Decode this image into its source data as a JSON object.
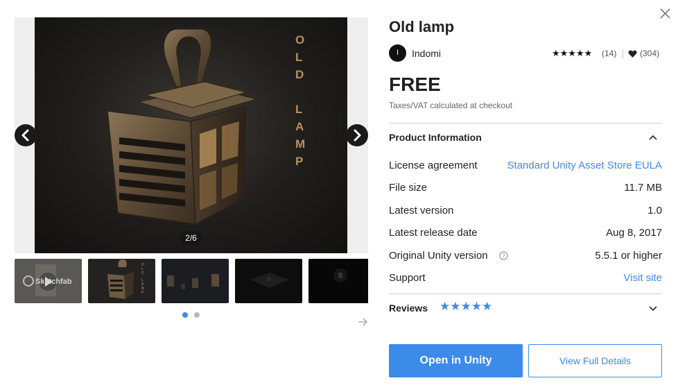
{
  "colors": {
    "accent": "#3d8be8",
    "text": "#212121",
    "muted": "#666666",
    "divider": "#cfcfcf"
  },
  "gallery": {
    "counter": "2/6",
    "prev_icon": "chevron-left-icon",
    "next_icon": "chevron-right-icon",
    "main_image_text": "OLD LAMP",
    "thumbnail_1_watermark": "Sketchfab",
    "thumbnail_2_text": "OLD LAMP",
    "dots_total": 2,
    "dots_active": 1,
    "thumb_next_icon": "arrow-right-icon"
  },
  "product": {
    "title": "Old lamp",
    "publisher_initial": "I",
    "publisher": "Indomi",
    "rating_stars": 5,
    "rating_count": "(14)",
    "favorites_count": "(304)",
    "price": "FREE",
    "tax_note": "Taxes/VAT calculated at checkout"
  },
  "info": {
    "heading": "Product Information",
    "rows": [
      {
        "label": "License agreement",
        "value": "Standard Unity Asset Store EULA"
      },
      {
        "label": "File size",
        "value": "11.7 MB"
      },
      {
        "label": "Latest version",
        "value": "1.0"
      },
      {
        "label": "Latest release date",
        "value": "Aug 8, 2017"
      },
      {
        "label": "Original Unity version",
        "value": "5.5.1 or higher"
      },
      {
        "label": "Support",
        "value": "Visit site"
      }
    ]
  },
  "reviews": {
    "heading": "Reviews",
    "stars": 5
  },
  "actions": {
    "primary": "Open in Unity",
    "secondary": "View Full Details"
  }
}
